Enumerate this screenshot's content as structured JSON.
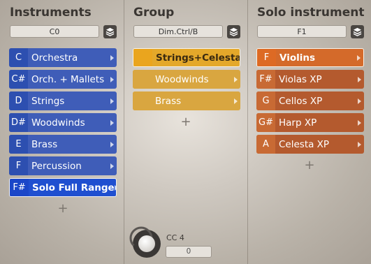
{
  "columns": {
    "instruments": {
      "title": "Instruments",
      "preset": "C0",
      "items": [
        {
          "key": "C",
          "label": "Orchestra",
          "selected": false
        },
        {
          "key": "C#",
          "label": "Orch. + Mallets",
          "selected": false
        },
        {
          "key": "D",
          "label": "Strings",
          "selected": false
        },
        {
          "key": "D#",
          "label": "Woodwinds",
          "selected": false
        },
        {
          "key": "E",
          "label": "Brass",
          "selected": false
        },
        {
          "key": "F",
          "label": "Percussion",
          "selected": false
        },
        {
          "key": "F#",
          "label": "Solo Full Range",
          "selected": true
        }
      ],
      "add": "+"
    },
    "group": {
      "title": "Group",
      "preset": "Dim.Ctrl/B",
      "items": [
        {
          "key": "",
          "label": "Strings+Celesta",
          "selected": true
        },
        {
          "key": "",
          "label": "Woodwinds",
          "selected": false
        },
        {
          "key": "",
          "label": "Brass",
          "selected": false
        }
      ],
      "add": "+"
    },
    "solo": {
      "title": "Solo instrument",
      "preset": "F1",
      "items": [
        {
          "key": "F",
          "label": "Violins",
          "selected": true
        },
        {
          "key": "F#",
          "label": "Violas XP",
          "selected": false
        },
        {
          "key": "G",
          "label": "Cellos XP",
          "selected": false
        },
        {
          "key": "G#",
          "label": "Harp XP",
          "selected": false
        },
        {
          "key": "A",
          "label": "Celesta XP",
          "selected": false
        }
      ],
      "add": "+"
    }
  },
  "cc": {
    "label": "CC 4",
    "value": "0"
  },
  "colors": {
    "instruments": "#3f5db8",
    "group": "#d9a640",
    "solo": "#b45a2e"
  },
  "icons": {
    "preset_menu": "layers-icon",
    "row_arrow": "chevron-right-icon",
    "add": "plus-icon"
  }
}
